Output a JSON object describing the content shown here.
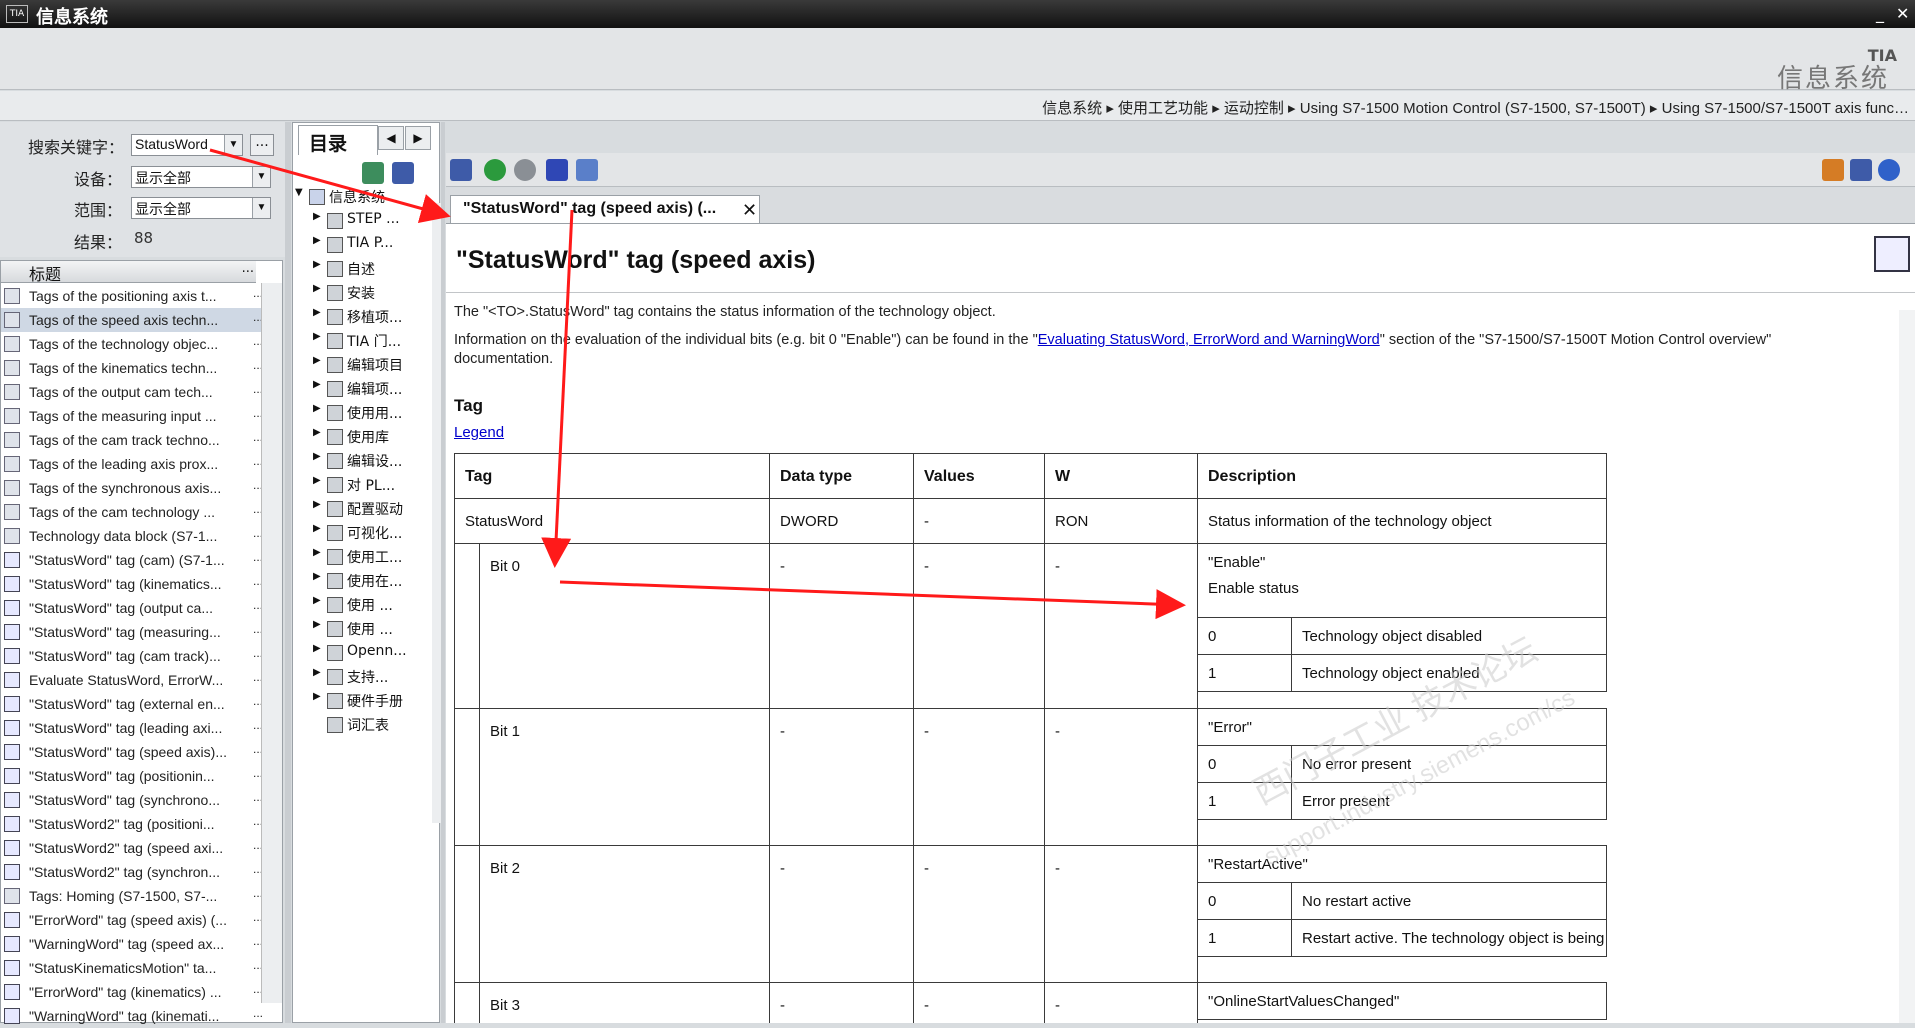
{
  "window": {
    "title": "信息系统",
    "min": "_",
    "max": "▫",
    "close": "✕",
    "logo": "TIA"
  },
  "brand": {
    "line1": "TIA",
    "line2": "信息系统"
  },
  "breadcrumb": "信息系统 ▸ 使用工艺功能 ▸ 运动控制 ▸ Using S7-1500 Motion Control (S7-1500, S7-1500T) ▸ Using S7-1500/S7-1500T axis func…",
  "search": {
    "keyword_label": "搜索关键字：",
    "keyword_value": "StatusWord",
    "device_label": "设备：",
    "device_value": "显示全部",
    "scope_label": "范围：",
    "scope_value": "显示全部",
    "results_label": "结果：",
    "results_value": "88",
    "more_button": "..."
  },
  "results": {
    "header": "标题",
    "header_more": "...",
    "items": [
      "Tags of the positioning axis t...",
      "Tags of the speed axis techn...",
      "Tags of the technology objec...",
      "Tags of the kinematics techn...",
      "Tags of the output cam tech...",
      "Tags of the measuring input ...",
      "Tags of the cam track techno...",
      "Tags of the leading axis prox...",
      "Tags of the synchronous axis...",
      "Tags of the cam technology ...",
      "Technology data block (S7-1...",
      "\"StatusWord\" tag (cam) (S7-1...",
      "\"StatusWord\" tag (kinematics...",
      "\"StatusWord\" tag (output ca...",
      "\"StatusWord\" tag (measuring...",
      "\"StatusWord\" tag (cam track)...",
      "Evaluate StatusWord, ErrorW...",
      "\"StatusWord\" tag (external en...",
      "\"StatusWord\" tag (leading axi...",
      "\"StatusWord\" tag (speed axis)...",
      "\"StatusWord\" tag (positionin...",
      "\"StatusWord\" tag (synchrono...",
      "\"StatusWord2\" tag (positioni...",
      "\"StatusWord2\" tag (speed axi...",
      "\"StatusWord2\" tag (synchron...",
      "Tags: Homing (S7-1500, S7-...",
      "\"ErrorWord\" tag (speed axis) (...",
      "\"WarningWord\" tag (speed ax...",
      "\"StatusKinematicsMotion\" ta...",
      "\"ErrorWord\" tag (kinematics) ...",
      "\"WarningWord\" tag (kinemati..."
    ],
    "row_more": "..."
  },
  "directory": {
    "tab": "目录",
    "root": "信息系统",
    "items": [
      "STEP ...",
      "TIA P...",
      "自述",
      "安装",
      "移植项...",
      "TIA 门...",
      "编辑项目",
      "编辑项...",
      "使用用...",
      "使用库",
      "编辑设...",
      "对 PL...",
      "配置驱动",
      "可视化...",
      "使用工...",
      "使用在...",
      "使用 ...",
      "使用 ...",
      "Openn...",
      "支持...",
      "硬件手册",
      "词汇表"
    ]
  },
  "tab": {
    "label": "\"StatusWord\" tag (speed axis) (...",
    "close": "✕"
  },
  "page": {
    "title": "\"StatusWord\" tag (speed axis)",
    "para1": "The \"<TO>.StatusWord\" tag contains the status information of the technology object.",
    "para2_pre": "Information on the evaluation of the individual bits (e.g. bit 0 \"Enable\") can be found in the \"",
    "para2_link": "Evaluating StatusWord, ErrorWord and WarningWord",
    "para2_post": "\" section of the \"S7-1500/S7-1500T Motion Control overview\"",
    "para2_cont": "documentation.",
    "tag_heading": "Tag",
    "legend": "Legend",
    "table": {
      "headers": [
        "Tag",
        "Data type",
        "Values",
        "W",
        "Description"
      ],
      "row": {
        "tag": "StatusWord",
        "type": "DWORD",
        "values": "-",
        "w": "RON",
        "desc": "Status information of the technology object"
      },
      "bits": [
        {
          "name": "Bit 0",
          "type": "-",
          "values": "-",
          "w": "-",
          "title": "\"Enable\"",
          "subtitle": "Enable status",
          "states": [
            {
              "v": "0",
              "t": "Technology object disabled"
            },
            {
              "v": "1",
              "t": "Technology object enabled"
            }
          ]
        },
        {
          "name": "Bit 1",
          "type": "-",
          "values": "-",
          "w": "-",
          "title": "\"Error\"",
          "states": [
            {
              "v": "0",
              "t": "No error present"
            },
            {
              "v": "1",
              "t": "Error present"
            }
          ]
        },
        {
          "name": "Bit 2",
          "type": "-",
          "values": "-",
          "w": "-",
          "title": "\"RestartActive\"",
          "states": [
            {
              "v": "0",
              "t": "No restart active"
            },
            {
              "v": "1",
              "t": "Restart active. The technology object is being reinitialized."
            }
          ]
        },
        {
          "name": "Bit 3",
          "type": "-",
          "values": "-",
          "w": "-",
          "title": "\"OnlineStartValuesChanged\""
        }
      ]
    },
    "watermark": "西门子工业 技术论坛",
    "watermark2": "support.industry.siemens.com/cs"
  },
  "colors": {
    "annotation": "#ff1a1a",
    "link": "#0000cc",
    "selection": "#cfd8e4"
  }
}
